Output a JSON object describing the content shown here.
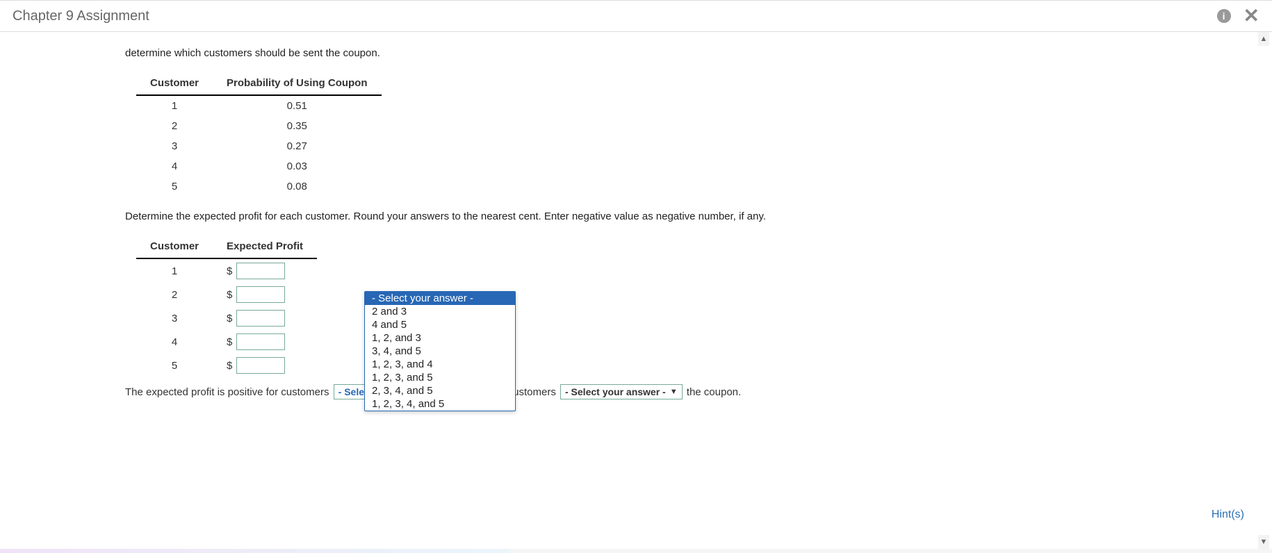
{
  "header": {
    "title": "Chapter 9 Assignment"
  },
  "intro_line": "determine which customers should be sent the coupon.",
  "table1": {
    "headers": [
      "Customer",
      "Probability of Using Coupon"
    ],
    "rows": [
      {
        "customer": "1",
        "prob": "0.51"
      },
      {
        "customer": "2",
        "prob": "0.35"
      },
      {
        "customer": "3",
        "prob": "0.27"
      },
      {
        "customer": "4",
        "prob": "0.03"
      },
      {
        "customer": "5",
        "prob": "0.08"
      }
    ]
  },
  "question": "Determine the expected profit for each customer. Round your answers to the nearest cent. Enter negative value as negative number, if any.",
  "table2": {
    "headers": [
      "Customer",
      "Expected Profit"
    ],
    "rows": [
      {
        "customer": "1",
        "value": ""
      },
      {
        "customer": "2",
        "value": ""
      },
      {
        "customer": "3",
        "value": ""
      },
      {
        "customer": "4",
        "value": ""
      },
      {
        "customer": "5",
        "value": ""
      }
    ],
    "currency": "$"
  },
  "sentence": {
    "part1": "The expected profit is positive for customers",
    "select1_label": "- Select your answer -",
    "part2": ", so these customers",
    "select2_label": "- Select your answer -",
    "part3": "the coupon."
  },
  "dropdown": {
    "options": [
      "- Select your answer -",
      "2 and 3",
      "4 and 5",
      "1, 2, and 3",
      "3, 4, and 5",
      "1, 2, 3, and 4",
      "1, 2, 3, and 5",
      "2, 3, 4, and 5",
      "1, 2, 3, 4, and 5"
    ],
    "selected_index": 0
  },
  "hints_label": "Hint(s)"
}
